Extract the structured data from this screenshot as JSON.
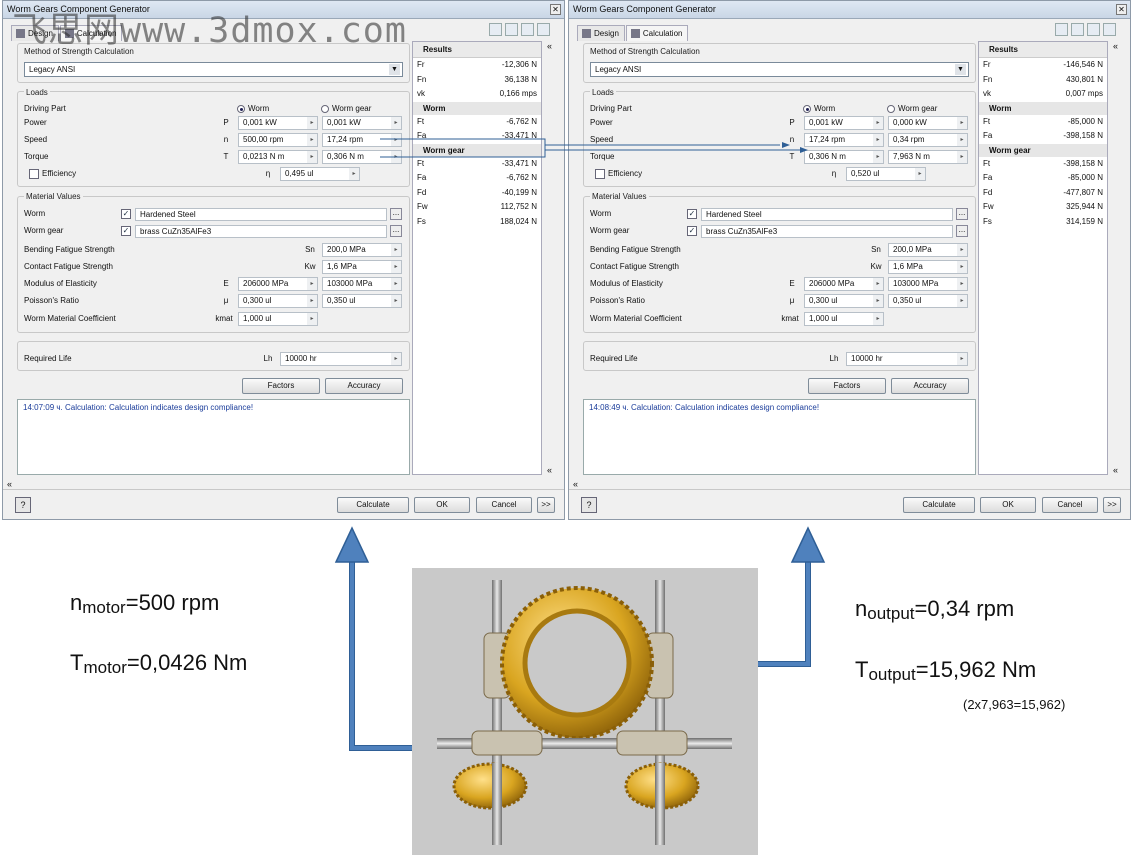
{
  "watermark": "飞思网www.3dmox.com",
  "left": {
    "title": "Worm Gears Component Generator",
    "tabs": [
      "Design",
      "Calculation"
    ],
    "method_label": "Method of Strength Calculation",
    "method_value": "Legacy ANSI",
    "loads_label": "Loads",
    "driving_part_label": "Driving Part",
    "radio_worm": "Worm",
    "radio_wormgear": "Worm gear",
    "power_label": "Power",
    "power_sym": "P",
    "power_1": "0,001 kW",
    "power_2": "0,001 kW",
    "speed_label": "Speed",
    "speed_sym": "n",
    "speed_1": "500,00 rpm",
    "speed_2": "17,24 rpm",
    "torque_label": "Torque",
    "torque_sym": "T",
    "torque_1": "0,0213 N m",
    "torque_2": "0,306 N m",
    "eff_label": "Efficiency",
    "eff_sym": "η",
    "eff_val": "0,495 ul",
    "mat_label": "Material Values",
    "worm_label": "Worm",
    "worm_mat": "Hardened Steel",
    "wormgear_label": "Worm gear",
    "wormgear_mat": "brass CuZn35AlFe3",
    "bend_label": "Bending Fatigue Strength",
    "bend_sym": "Sn",
    "bend_val": "200,0 MPa",
    "contact_label": "Contact Fatigue Strength",
    "contact_sym": "Kw",
    "contact_val": "1,6 MPa",
    "mod_label": "Modulus of Elasticity",
    "mod_sym": "E",
    "mod_1": "206000 MPa",
    "mod_2": "103000 MPa",
    "pois_label": "Poisson's Ratio",
    "pois_sym": "μ",
    "pois_1": "0,300 ul",
    "pois_2": "0,350 ul",
    "coef_label": "Worm Material Coefficient",
    "coef_sym": "kmat",
    "coef_val": "1,000 ul",
    "life_label": "Required Life",
    "life_sym": "Lh",
    "life_val": "10000 hr",
    "factors": "Factors",
    "accuracy": "Accuracy",
    "message": "14:07:09 ч. Calculation: Calculation indicates design compliance!",
    "results_title": "Results",
    "res_top": [
      [
        "Fr",
        "-12,306 N"
      ],
      [
        "Fn",
        "36,138 N"
      ],
      [
        "vk",
        "0,166 mps"
      ]
    ],
    "res_worm_title": "Worm",
    "res_worm": [
      [
        "Ft",
        "-6,762 N"
      ],
      [
        "Fa",
        "-33,471 N"
      ]
    ],
    "res_gear_title": "Worm gear",
    "res_gear": [
      [
        "Ft",
        "-33,471 N"
      ],
      [
        "Fa",
        "-6,762 N"
      ],
      [
        "Fd",
        "-40,199 N"
      ],
      [
        "Fw",
        "112,752 N"
      ],
      [
        "Fs",
        "188,024 N"
      ]
    ],
    "calculate": "Calculate",
    "ok": "OK",
    "cancel": "Cancel",
    "more": ">>",
    "help": "?"
  },
  "right": {
    "title": "Worm Gears Component Generator",
    "tabs": [
      "Design",
      "Calculation"
    ],
    "method_label": "Method of Strength Calculation",
    "method_value": "Legacy ANSI",
    "loads_label": "Loads",
    "driving_part_label": "Driving Part",
    "radio_worm": "Worm",
    "radio_wormgear": "Worm gear",
    "power_label": "Power",
    "power_sym": "P",
    "power_1": "0,001 kW",
    "power_2": "0,000 kW",
    "speed_label": "Speed",
    "speed_sym": "n",
    "speed_1": "17,24 rpm",
    "speed_2": "0,34 rpm",
    "torque_label": "Torque",
    "torque_sym": "T",
    "torque_1": "0,306 N m",
    "torque_2": "7,963 N m",
    "eff_label": "Efficiency",
    "eff_sym": "η",
    "eff_val": "0,520 ul",
    "mat_label": "Material Values",
    "worm_label": "Worm",
    "worm_mat": "Hardened Steel",
    "wormgear_label": "Worm gear",
    "wormgear_mat": "brass CuZn35AlFe3",
    "bend_label": "Bending Fatigue Strength",
    "bend_sym": "Sn",
    "bend_val": "200,0 MPa",
    "contact_label": "Contact Fatigue Strength",
    "contact_sym": "Kw",
    "contact_val": "1,6 MPa",
    "mod_label": "Modulus of Elasticity",
    "mod_sym": "E",
    "mod_1": "206000 MPa",
    "mod_2": "103000 MPa",
    "pois_label": "Poisson's Ratio",
    "pois_sym": "μ",
    "pois_1": "0,300 ul",
    "pois_2": "0,350 ul",
    "coef_label": "Worm Material Coefficient",
    "coef_sym": "kmat",
    "coef_val": "1,000 ul",
    "life_label": "Required Life",
    "life_sym": "Lh",
    "life_val": "10000 hr",
    "factors": "Factors",
    "accuracy": "Accuracy",
    "message": "14:08:49 ч. Calculation: Calculation indicates design compliance!",
    "results_title": "Results",
    "res_top": [
      [
        "Fr",
        "-146,546 N"
      ],
      [
        "Fn",
        "430,801 N"
      ],
      [
        "vk",
        "0,007 mps"
      ]
    ],
    "res_worm_title": "Worm",
    "res_worm": [
      [
        "Ft",
        "-85,000 N"
      ],
      [
        "Fa",
        "-398,158 N"
      ]
    ],
    "res_gear_title": "Worm gear",
    "res_gear": [
      [
        "Ft",
        "-398,158 N"
      ],
      [
        "Fa",
        "-85,000 N"
      ],
      [
        "Fd",
        "-477,807 N"
      ],
      [
        "Fw",
        "325,944 N"
      ],
      [
        "Fs",
        "314,159 N"
      ]
    ],
    "calculate": "Calculate",
    "ok": "OK",
    "cancel": "Cancel",
    "more": ">>",
    "help": "?"
  },
  "annotations": {
    "n_motor_base": "n",
    "n_motor_sub": "motor",
    "n_motor_val": "=500 rpm",
    "t_motor_base": "T",
    "t_motor_sub": "motor",
    "t_motor_val": "=0,0426 Nm",
    "n_out_base": "n",
    "n_out_sub": "output",
    "n_out_val": "=0,34 rpm",
    "t_out_base": "T",
    "t_out_sub": "output",
    "t_out_val": "=15,962 Nm",
    "note": "(2x7,963=15,962)"
  },
  "colors": {
    "arrow": "#4f81bd",
    "arrow_dark": "#2f5f96",
    "gear_gold": "#d9a520",
    "shaft": "#a8a8a8",
    "bg_gray": "#c9c9c9"
  }
}
